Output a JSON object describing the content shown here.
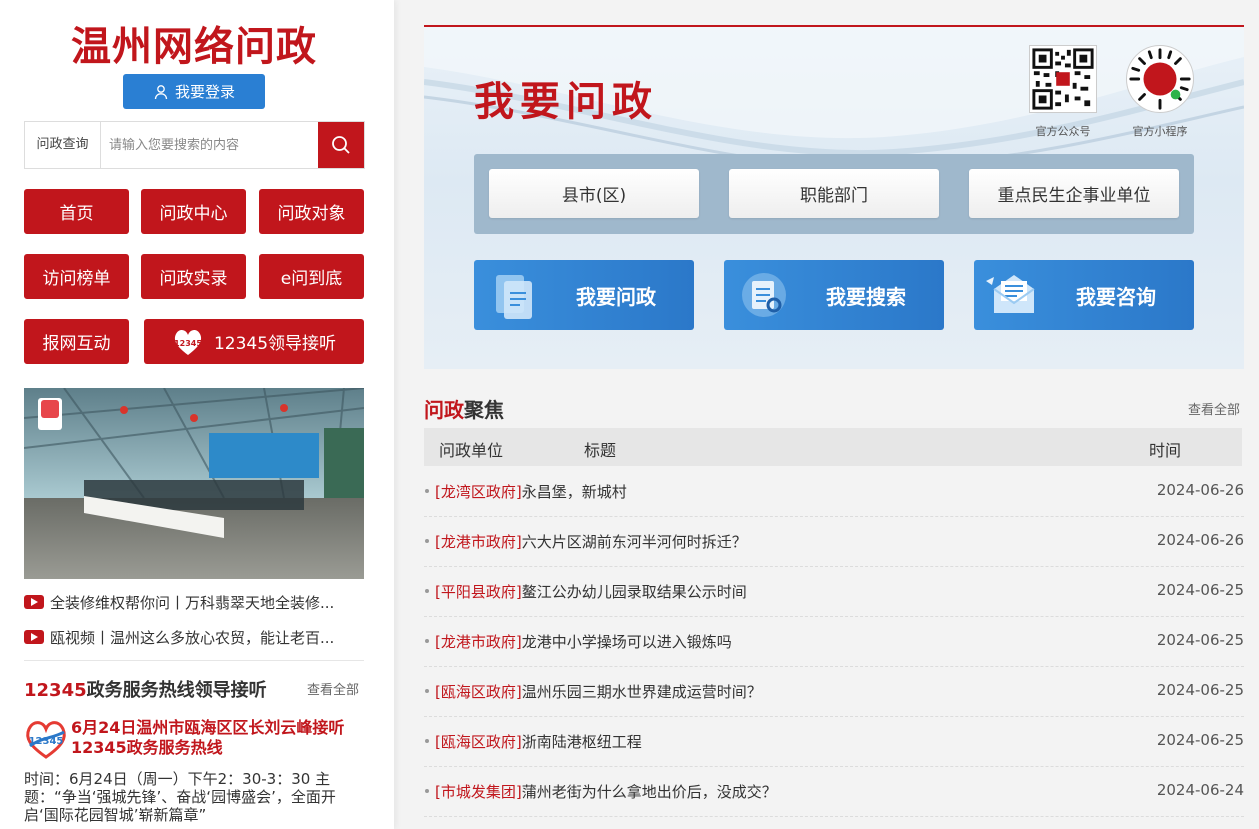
{
  "site": {
    "title": "温州网络问政",
    "login_label": "我要登录"
  },
  "search": {
    "label": "问政查询",
    "placeholder": "请输入您要搜索的内容"
  },
  "nav": {
    "home": "首页",
    "center": "问政中心",
    "object": "问政对象",
    "ranking": "访问榜单",
    "reality": "问政实录",
    "eask": "e问到底",
    "interact": "报网互动",
    "leader": "12345领导接听"
  },
  "videos": [
    "全装修维权帮你问丨万科翡翠天地全装修...",
    "瓯视频丨温州这么多放心农贸，能让老百..."
  ],
  "hotline": {
    "title_red": "12345",
    "title_rest": "政务服务热线领导接听",
    "view_all": "查看全部",
    "headline": "6月24日温州市瓯海区区长刘云峰接听12345政务服务热线",
    "description": "时间：6月24日（周一）下午2：30-3：30 主题：“争当‘强城先锋’、奋战‘园博盛会’，全面开启‘国际花园智城’崭新篇章”"
  },
  "banner": {
    "title": "我要问政",
    "qr_official": "官方公众号",
    "qr_mini": "官方小程序",
    "categories": [
      "县市(区)",
      "职能部门",
      "重点民生企事业单位"
    ],
    "actions": [
      "我要问政",
      "我要搜索",
      "我要咨询"
    ]
  },
  "focus": {
    "title_red": "问政",
    "title_rest": "聚焦",
    "view_all": "查看全部",
    "headers": {
      "unit": "问政单位",
      "title": "标题",
      "time": "时间"
    },
    "rows": [
      {
        "unit": "[龙湾区政府]",
        "title": "永昌堡，新城村",
        "date": "2024-06-26"
      },
      {
        "unit": "[龙港市政府]",
        "title": "六大片区湖前东河半河何时拆迁？",
        "date": "2024-06-26"
      },
      {
        "unit": "[平阳县政府]",
        "title": "鳌江公办幼儿园录取结果公示时间",
        "date": "2024-06-25"
      },
      {
        "unit": "[龙港市政府]",
        "title": "龙港中小学操场可以进入锻炼吗",
        "date": "2024-06-25"
      },
      {
        "unit": "[瓯海区政府]",
        "title": "温州乐园三期水世界建成运营时间？",
        "date": "2024-06-25"
      },
      {
        "unit": "[瓯海区政府]",
        "title": "浙南陆港枢纽工程",
        "date": "2024-06-25"
      },
      {
        "unit": "[市城发集团]",
        "title": "蒲州老街为什么拿地出价后，没成交？",
        "date": "2024-06-24"
      }
    ]
  },
  "colors": {
    "brand_red": "#c1161c",
    "brand_blue": "#2a7fd3"
  }
}
